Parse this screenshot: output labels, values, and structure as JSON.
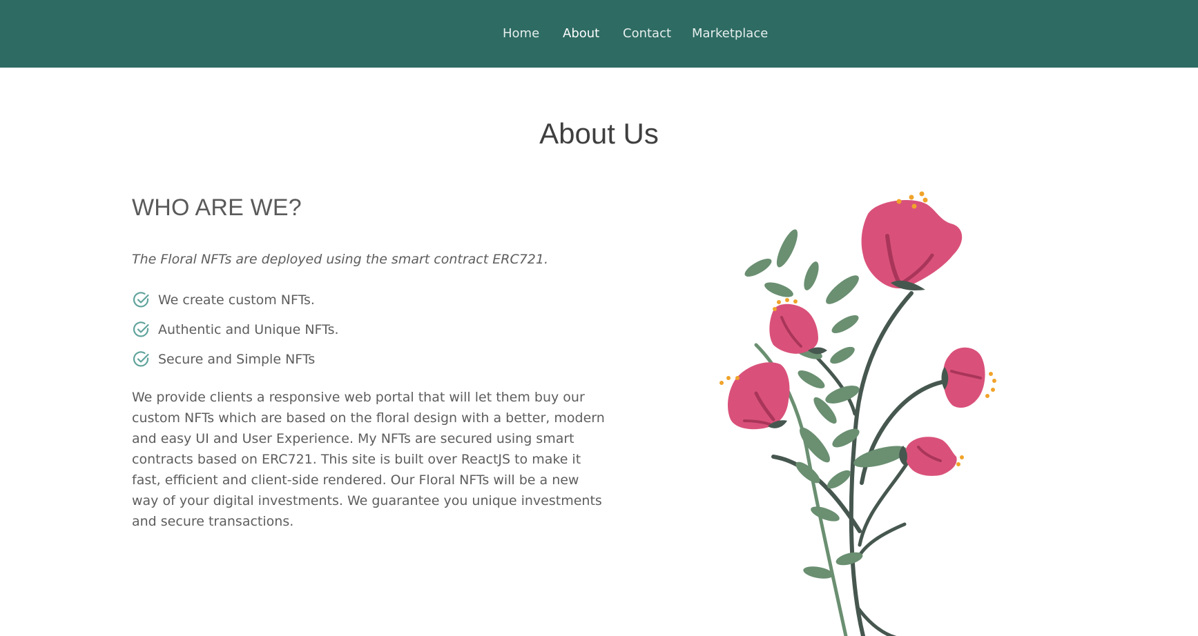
{
  "nav": {
    "items": [
      {
        "label": "Home",
        "active": false
      },
      {
        "label": "About",
        "active": true
      },
      {
        "label": "Contact",
        "active": false
      },
      {
        "label": "Marketplace",
        "active": false
      }
    ]
  },
  "page": {
    "title": "About Us"
  },
  "about": {
    "heading": "WHO ARE WE?",
    "lead": "The Floral NFTs are deployed using the smart contract ERC721.",
    "features": [
      {
        "text": "We create custom NFTs.",
        "icon": "check-circle-icon"
      },
      {
        "text": "Authentic and Unique NFTs.",
        "icon": "check-circle-icon"
      },
      {
        "text": "Secure and Simple NFTs",
        "icon": "check-circle-icon"
      }
    ],
    "description": "We provide clients a responsive web portal that will let them buy our custom NFTs which are based on the floral design with a better, modern and easy UI and User Experience. My NFTs are secured using smart contracts based on ERC721. This site is built over ReactJS to make it fast, efficient and client-side rendered. Our Floral NFTs will be a new way of your digital investments. We guarantee you unique investments and secure transactions."
  },
  "colors": {
    "nav_background": "#2e6b63",
    "accent_check": "#5fa39b",
    "petal": "#d9517a",
    "leaf": "#6a8f71",
    "stem": "#46574f",
    "stamen": "#f0a32a"
  }
}
